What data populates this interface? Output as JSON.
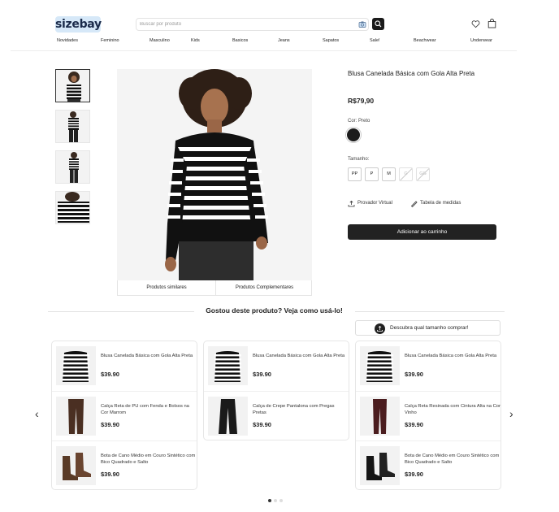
{
  "header": {
    "logo": "sizebay",
    "search_placeholder": "Buscar por produto",
    "nav": [
      "Novidades",
      "Feminino",
      "Masculino",
      "Kids",
      "Basicos",
      "Jeans",
      "Sapatos",
      "Sale!",
      "Beachwear",
      "Underwear"
    ]
  },
  "product": {
    "title": "Blusa Canelada Básica com Gola Alta Preta",
    "price": "R$79,90",
    "color_label": "Cor: Preto",
    "color_hex": "#1c1c1c",
    "size_label": "Tamanho:",
    "sizes": [
      {
        "label": "PP",
        "available": true
      },
      {
        "label": "P",
        "available": true
      },
      {
        "label": "M",
        "available": true
      },
      {
        "label": "G",
        "available": false
      },
      {
        "label": "GG",
        "available": false
      }
    ],
    "virtual_fitter": "Provador Virtual",
    "size_chart": "Tabela de medidas",
    "add_to_cart": "Adicionar ao carrinho",
    "tabs": [
      "Produtos similares",
      "Produtos Complementares"
    ]
  },
  "section": {
    "title": "Gostou deste produto? Veja como usá-lo!",
    "size_finder": "Descubra qual tamanho comprar!"
  },
  "looks": [
    {
      "items": [
        {
          "name": "Blusa Canelada Básica com Gola Alta Preta",
          "price": "$39.90",
          "kind": "top"
        },
        {
          "name": "Calça Reta de PU com Fenda e Bolsos na Cor Marrom",
          "price": "$39.90",
          "kind": "pants-brown"
        },
        {
          "name": "Bota de Cano Médio em Couro Sintético com Bico Quadrado e Salto",
          "price": "$39.90",
          "kind": "boots-brown"
        }
      ]
    },
    {
      "items": [
        {
          "name": "Blusa Canelada Básica com Gola Alta Preta",
          "price": "$39.90",
          "kind": "top"
        },
        {
          "name": "Calça de Crepe Pantalona com Pregas Pretas",
          "price": "$39.90",
          "kind": "pants-black"
        }
      ]
    },
    {
      "items": [
        {
          "name": "Blusa Canelada Básica com Gola Alta Preta",
          "price": "$39.90",
          "kind": "top"
        },
        {
          "name": "Calça Reta Resinada com Cintura Alta na Cor Vinho",
          "price": "$39.90",
          "kind": "pants-wine"
        },
        {
          "name": "Bota de Cano Médio em Couro Sintético com Bico Quadrado e Salto",
          "price": "$39.90",
          "kind": "boots-black"
        }
      ]
    }
  ],
  "carousel": {
    "prev": "‹",
    "next": "›",
    "pages": 3,
    "active": 0
  }
}
